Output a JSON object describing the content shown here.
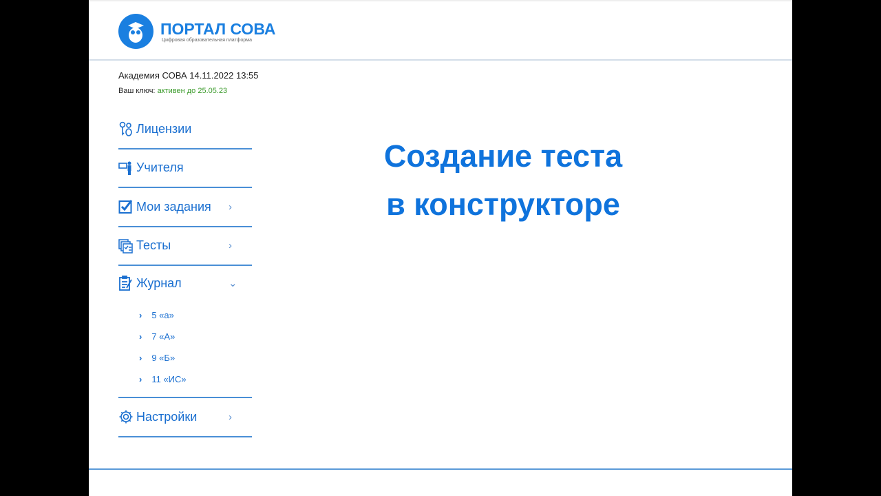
{
  "brand": {
    "name": "ПОРТАЛ СОВА",
    "tagline": "Цифровая образовательная платформа"
  },
  "org_line": "Академия СОВА 14.11.2022 13:55",
  "key": {
    "label": "Ваш ключ:",
    "status": "активен до 25.05.23"
  },
  "nav": [
    {
      "label": "Лицензии",
      "icon": "keys-icon"
    },
    {
      "label": "Учителя",
      "icon": "teacher-icon"
    },
    {
      "label": "Мои задания",
      "icon": "checkbox-icon",
      "chevron": "›"
    },
    {
      "label": "Тесты",
      "icon": "tests-icon",
      "chevron": "›"
    },
    {
      "label": "Журнал",
      "icon": "journal-icon",
      "chevron": "⌄"
    },
    {
      "label": "Настройки",
      "icon": "gear-icon",
      "chevron": "›"
    }
  ],
  "journal_classes": [
    "5 «а»",
    "7 «А»",
    "9 «Б»",
    "11 «ИС»"
  ],
  "main_title": [
    "Создание теста",
    "в конструкторе"
  ],
  "colors": {
    "accent": "#1a7fe0",
    "active": "#3a9a2a"
  }
}
